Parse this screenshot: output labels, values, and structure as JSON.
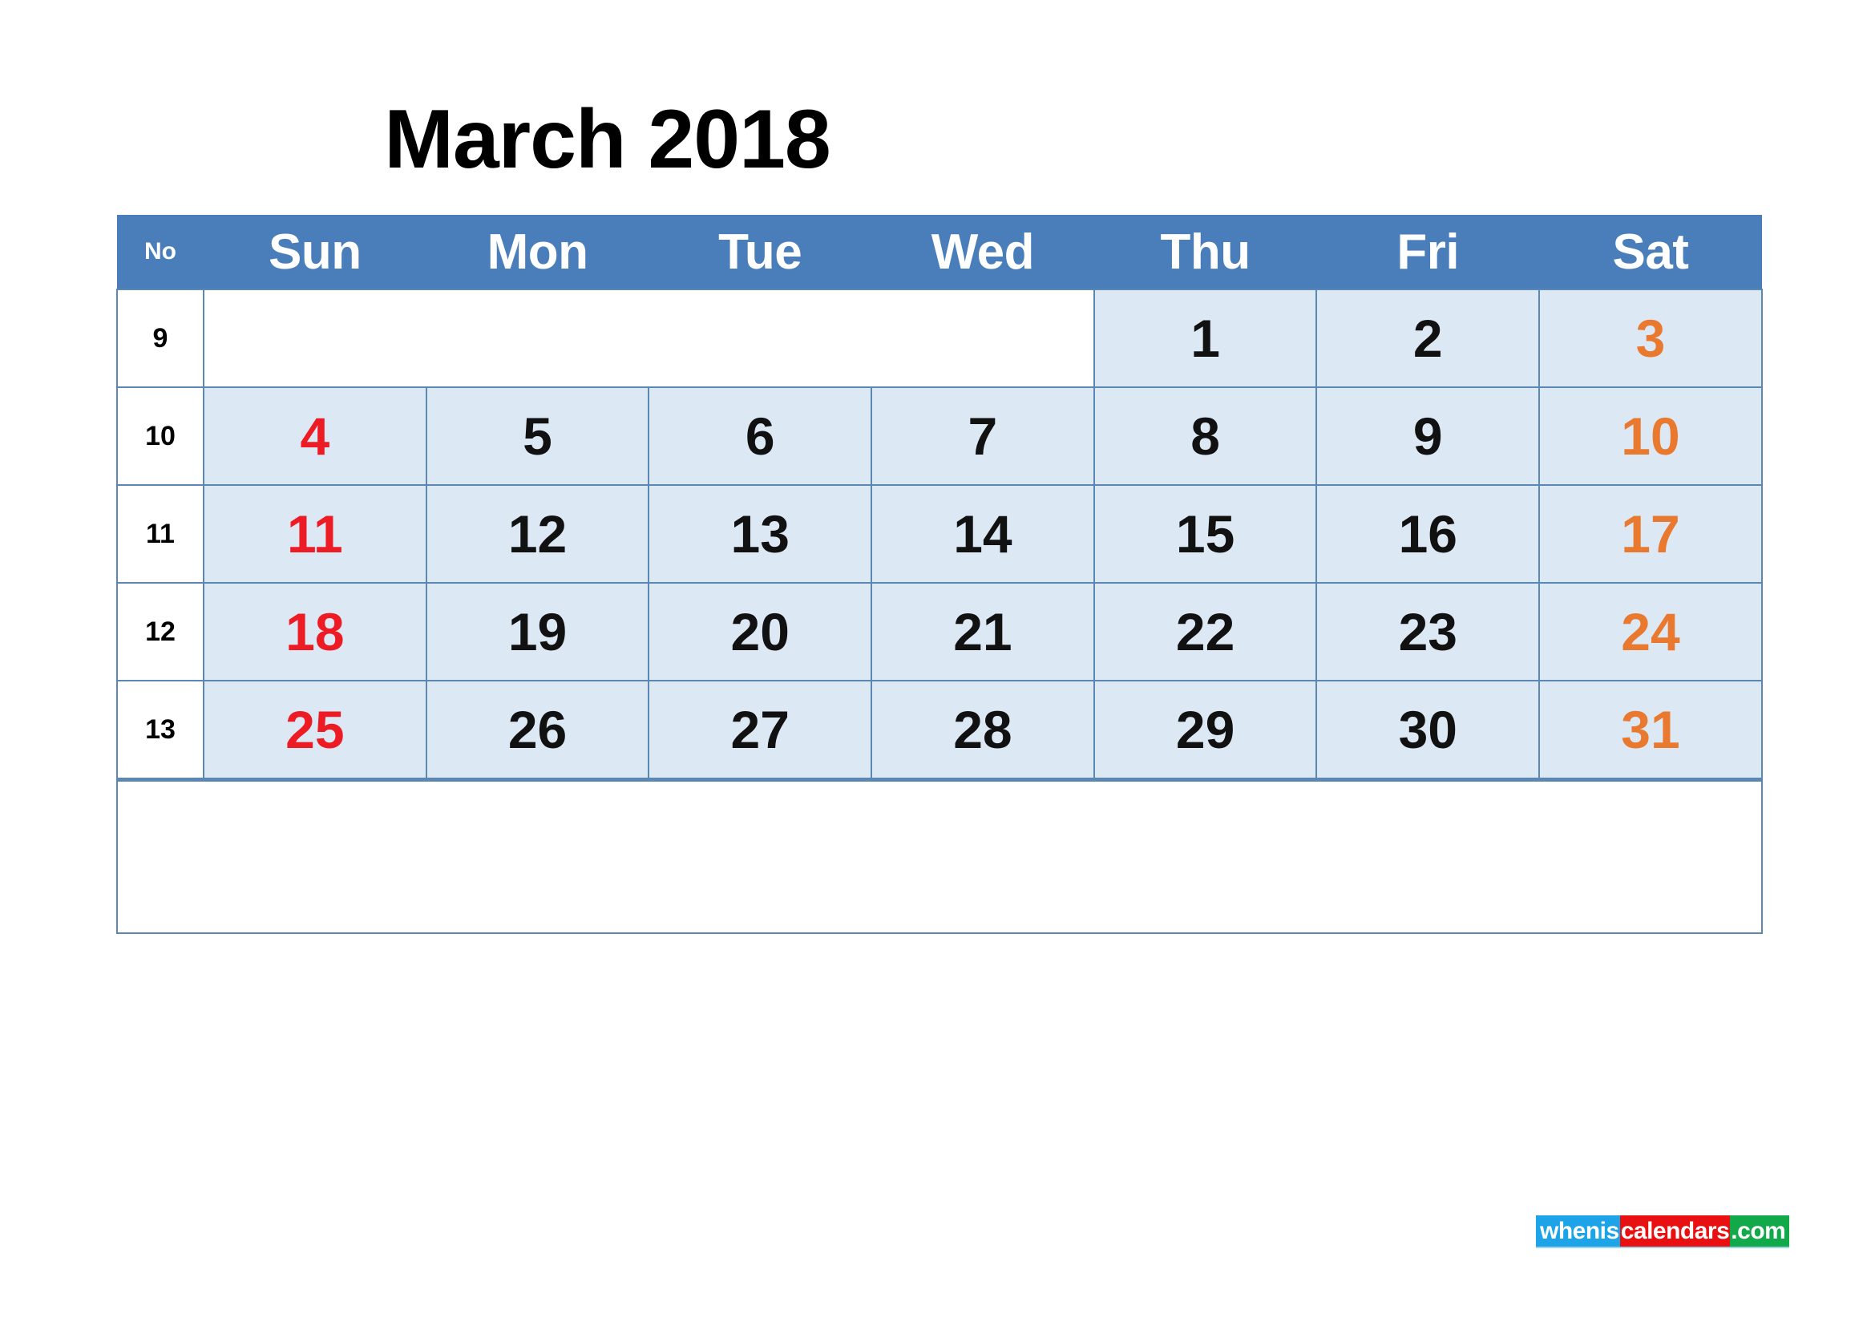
{
  "page": {
    "title": "March 2018",
    "month": "March",
    "year": "2018"
  },
  "calendar": {
    "weekno_header": "No",
    "day_headers": [
      "Sun",
      "Mon",
      "Tue",
      "Wed",
      "Thu",
      "Fri",
      "Sat"
    ],
    "colors": {
      "header_bg": "#4A7EBB",
      "header_text": "#FFFFFF",
      "cell_bg": "#DDE8F5",
      "border": "#5B87B3",
      "weekno_bg": "#FFFFFF",
      "sunday_text": "#ED1C24",
      "saturday_text": "#E8792E",
      "weekday_text": "#111111"
    },
    "weeks": [
      {
        "weekno": "9",
        "leading_blank_span": 4,
        "days": [
          {
            "label": "",
            "kind": "blank"
          },
          {
            "label": "",
            "kind": "blank"
          },
          {
            "label": "",
            "kind": "blank"
          },
          {
            "label": "",
            "kind": "blank"
          },
          {
            "label": "1",
            "kind": "wkd"
          },
          {
            "label": "2",
            "kind": "wkd"
          },
          {
            "label": "3",
            "kind": "sat"
          }
        ]
      },
      {
        "weekno": "10",
        "leading_blank_span": 0,
        "days": [
          {
            "label": "4",
            "kind": "sun"
          },
          {
            "label": "5",
            "kind": "wkd"
          },
          {
            "label": "6",
            "kind": "wkd"
          },
          {
            "label": "7",
            "kind": "wkd"
          },
          {
            "label": "8",
            "kind": "wkd"
          },
          {
            "label": "9",
            "kind": "wkd"
          },
          {
            "label": "10",
            "kind": "sat"
          }
        ]
      },
      {
        "weekno": "11",
        "leading_blank_span": 0,
        "days": [
          {
            "label": "11",
            "kind": "sun"
          },
          {
            "label": "12",
            "kind": "wkd"
          },
          {
            "label": "13",
            "kind": "wkd"
          },
          {
            "label": "14",
            "kind": "wkd"
          },
          {
            "label": "15",
            "kind": "wkd"
          },
          {
            "label": "16",
            "kind": "wkd"
          },
          {
            "label": "17",
            "kind": "sat"
          }
        ]
      },
      {
        "weekno": "12",
        "leading_blank_span": 0,
        "days": [
          {
            "label": "18",
            "kind": "sun"
          },
          {
            "label": "19",
            "kind": "wkd"
          },
          {
            "label": "20",
            "kind": "wkd"
          },
          {
            "label": "21",
            "kind": "wkd"
          },
          {
            "label": "22",
            "kind": "wkd"
          },
          {
            "label": "23",
            "kind": "wkd"
          },
          {
            "label": "24",
            "kind": "sat"
          }
        ]
      },
      {
        "weekno": "13",
        "leading_blank_span": 0,
        "days": [
          {
            "label": "25",
            "kind": "sun"
          },
          {
            "label": "26",
            "kind": "wkd"
          },
          {
            "label": "27",
            "kind": "wkd"
          },
          {
            "label": "28",
            "kind": "wkd"
          },
          {
            "label": "29",
            "kind": "wkd"
          },
          {
            "label": "30",
            "kind": "wkd"
          },
          {
            "label": "31",
            "kind": "sat"
          }
        ]
      }
    ],
    "footer_note": ""
  },
  "logo": {
    "segments": [
      {
        "text": "whenis",
        "color": "#1CA3E8"
      },
      {
        "text": "calendars",
        "color": "#E81010"
      },
      {
        "text": ".com",
        "color": "#12A94A"
      }
    ],
    "full_text": "wheniscalendars.com"
  }
}
